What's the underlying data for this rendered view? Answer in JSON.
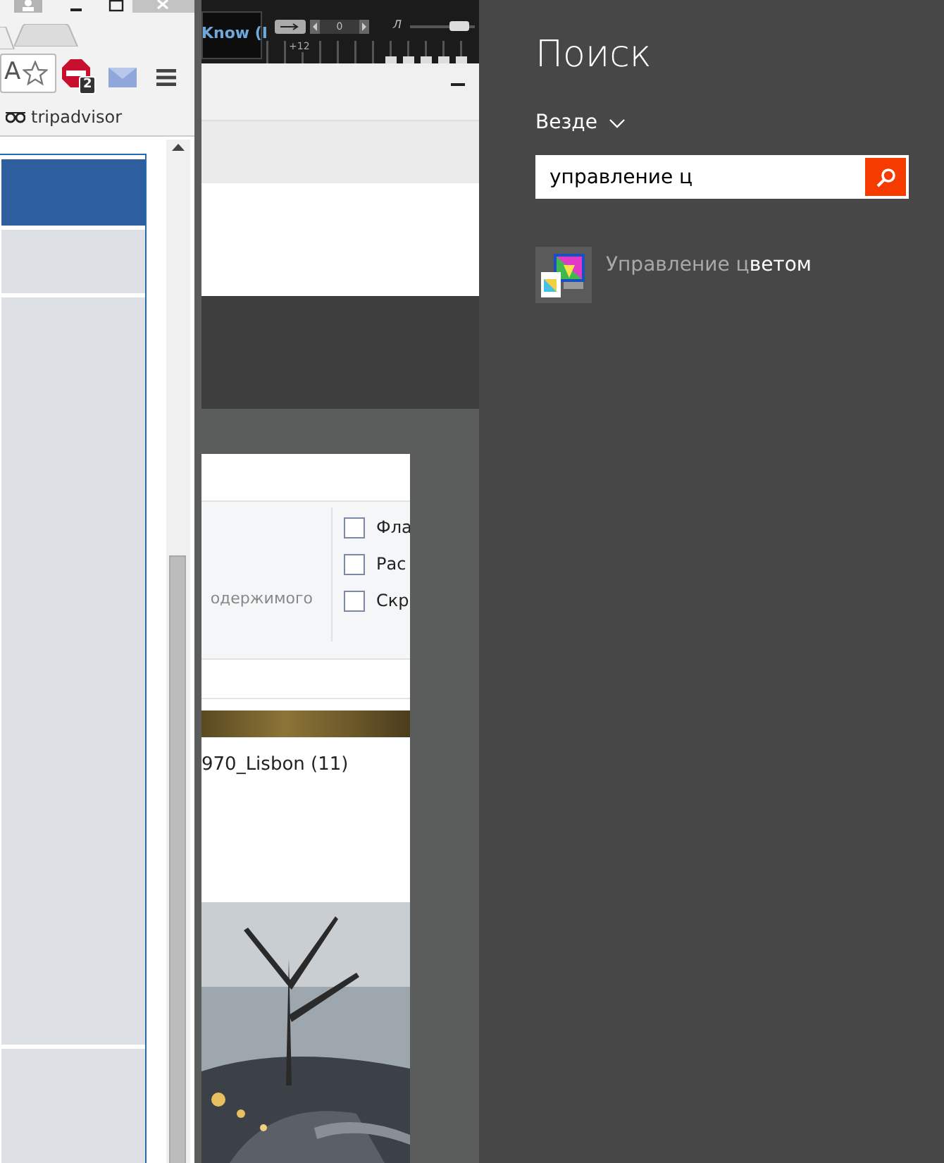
{
  "browser": {
    "address_bar": {
      "value": "A"
    },
    "extensions": [
      {
        "kind": "abp",
        "badge": "2"
      },
      {
        "kind": "mail"
      }
    ],
    "bookmarks": [
      {
        "label": "tripadvisor"
      }
    ]
  },
  "player": {
    "track": "Know (I",
    "counter": "0",
    "eq_label": "+12",
    "slider_label": "Л",
    "volume": {
      "level": 0.75
    }
  },
  "explorer": {
    "ribbon_text": "одержимого",
    "options": [
      {
        "label": "Фла",
        "checked": false
      },
      {
        "label": "Рас",
        "checked": false
      },
      {
        "label": "Скр",
        "checked": false
      }
    ],
    "folder": "970_Lisbon (11)"
  },
  "search": {
    "title": "Поиск",
    "scope": "Везде",
    "query": "управление ц",
    "results": [
      {
        "label": "Управление ц**ветом**"
      }
    ]
  }
}
